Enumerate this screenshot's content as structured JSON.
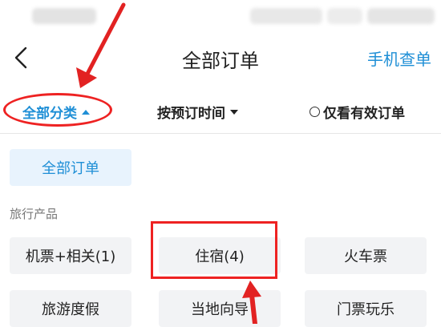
{
  "header": {
    "title": "全部订单",
    "phone_query": "手机查单"
  },
  "filters": {
    "category": "全部分类",
    "sort_time": "按预订时间",
    "valid_only": "仅看有效订单"
  },
  "panel": {
    "all_orders": "全部订单",
    "section_label": "旅行产品",
    "items": [
      {
        "label": "机票+相关(1)"
      },
      {
        "label": "住宿(4)"
      },
      {
        "label": "火车票"
      },
      {
        "label": "旅游度假"
      },
      {
        "label": "当地向导"
      },
      {
        "label": "门票玩乐"
      }
    ]
  },
  "colors": {
    "accent": "#1f8fd6",
    "annotation": "#e22222",
    "chip_bg": "#f2f3f5",
    "chip_active_bg": "#e8f3fd"
  },
  "icons": {
    "back": "chevron-left-icon",
    "category_caret": "caret-up-icon",
    "time_caret": "caret-down-icon",
    "valid_radio": "radio-unchecked-icon"
  }
}
